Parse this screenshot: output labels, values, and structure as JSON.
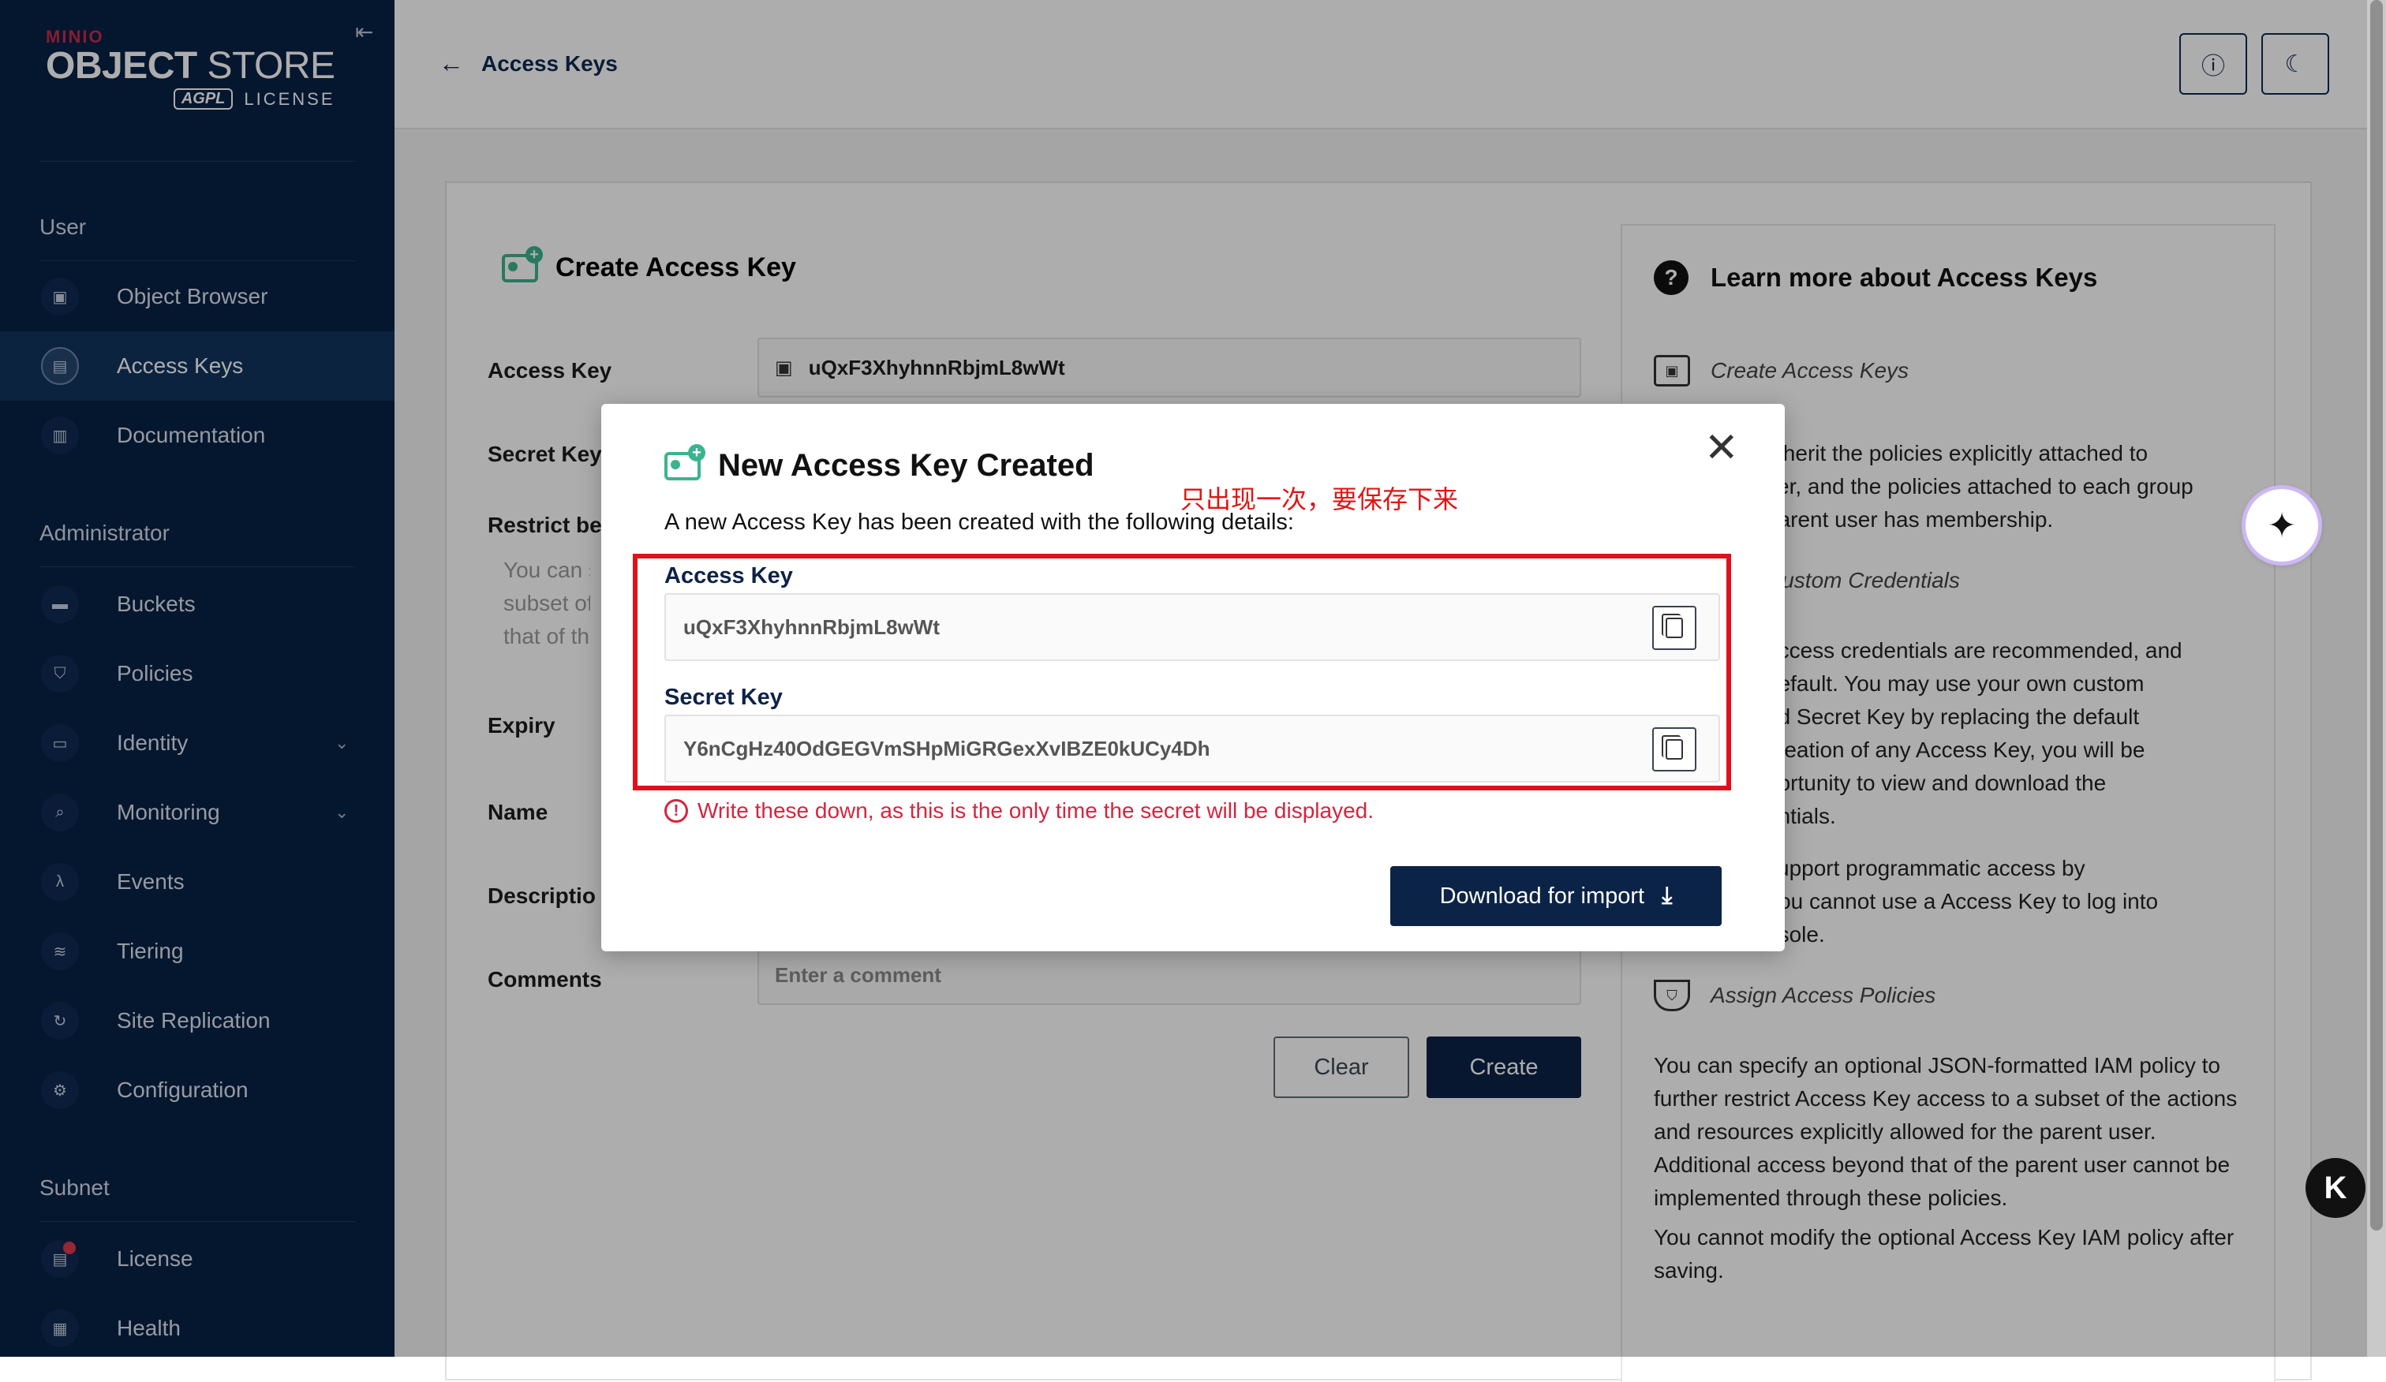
{
  "brand": {
    "minio": "MINIO",
    "object": "OBJECT",
    "store": "STORE",
    "agpl": "AGPL",
    "license": "LICENSE"
  },
  "sidebar": {
    "sections": [
      {
        "heading": "User",
        "items": [
          {
            "label": "Object Browser",
            "icon": "object-browser-icon"
          },
          {
            "label": "Access Keys",
            "icon": "access-keys-icon",
            "active": true
          },
          {
            "label": "Documentation",
            "icon": "documentation-icon"
          }
        ]
      },
      {
        "heading": "Administrator",
        "items": [
          {
            "label": "Buckets",
            "icon": "bucket-icon"
          },
          {
            "label": "Policies",
            "icon": "policy-icon"
          },
          {
            "label": "Identity",
            "icon": "identity-icon",
            "expandable": true
          },
          {
            "label": "Monitoring",
            "icon": "monitoring-icon",
            "expandable": true
          },
          {
            "label": "Events",
            "icon": "lambda-icon"
          },
          {
            "label": "Tiering",
            "icon": "tiering-icon"
          },
          {
            "label": "Site Replication",
            "icon": "replication-icon"
          },
          {
            "label": "Configuration",
            "icon": "gear-icon"
          }
        ]
      },
      {
        "heading": "Subnet",
        "items": [
          {
            "label": "License",
            "icon": "license-icon"
          },
          {
            "label": "Health",
            "icon": "health-icon"
          }
        ]
      }
    ]
  },
  "header": {
    "back_label": "Access Keys"
  },
  "form": {
    "title": "Create Access Key",
    "access_key_label": "Access Key",
    "access_key_value": "uQxF3XhyhnnRbjmL8wWt",
    "secret_key_label": "Secret Key",
    "restrict_label": "Restrict be",
    "help_lines": [
      "You can s",
      "subset of",
      "that of th"
    ],
    "expiry_label": "Expiry",
    "name_label": "Name",
    "description_label": "Descriptio",
    "comments_label": "Comments",
    "comments_placeholder": "Enter a comment",
    "clear_label": "Clear",
    "create_label": "Create"
  },
  "learn": {
    "title": "Learn more about Access Keys",
    "sub1": "Create Access Keys",
    "p1": "inherit the policies explicitly attached to\nser, and the policies attached to each group\nparent user has membership.",
    "sub2": "Custom Credentials",
    "p2": "access credentials are recommended, and\ndefault. You may use your own custom\nnd Secret Key by replacing the default\ncreation of any Access Key, you will be\nportunity to view and download the\nentials.",
    "p3": "support programmatic access by\nYou cannot use a Access Key to log into\nnsole.",
    "sub3": "Assign Access Policies",
    "p4": "You can specify an optional JSON-formatted IAM policy to further restrict Access Key access to a subset of the actions and resources explicitly allowed for the parent user. Additional access beyond that of the parent user cannot be implemented through these policies.",
    "p5": "You cannot modify the optional Access Key IAM policy after saving."
  },
  "modal": {
    "title": "New Access Key Created",
    "annotation": "只出现一次，要保存下来",
    "description": "A new Access Key has been created with the following details:",
    "access_key_label": "Access Key",
    "access_key_value": "uQxF3XhyhnnRbjmL8wWt",
    "secret_key_label": "Secret Key",
    "secret_key_value": "Y6nCgHz40OdGEGVmSHpMiGRGexXvIBZE0kUCy4Dh",
    "warning": "Write these down, as this is the only time the secret will be displayed.",
    "download_label": "Download for import"
  },
  "colors": {
    "sidebar_bg": "#082146",
    "primary": "#0b2347",
    "warning": "#d4253f",
    "annotation": "#e01515",
    "accent_green": "#3bb38e"
  }
}
